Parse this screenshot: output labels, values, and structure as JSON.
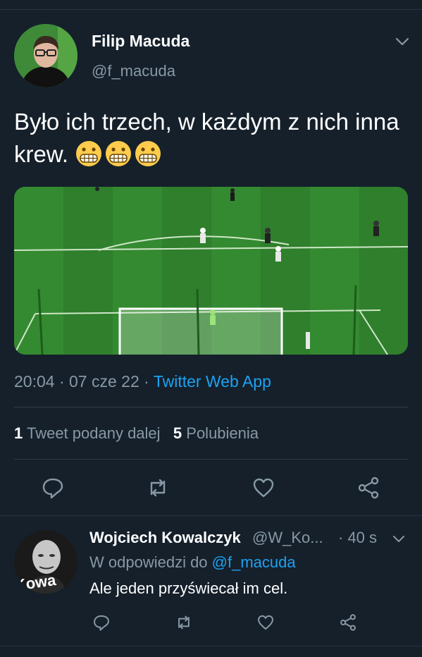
{
  "tweet": {
    "author_name": "Filip Macuda",
    "author_handle": "@f_macuda",
    "text": "Było ich trzech, w każdym z nich inna krew.",
    "emoji": [
      "grimacing-face",
      "grimacing-face",
      "grimacing-face"
    ],
    "time": "20:04",
    "date": "07 cze 22",
    "separator": "·",
    "source": "Twitter Web App",
    "retweets_count": "1",
    "retweets_label": "Tweet podany dalej",
    "likes_count": "5",
    "likes_label": "Polubienia"
  },
  "actions": [
    "reply-icon",
    "retweet-icon",
    "like-icon",
    "share-icon"
  ],
  "reply": {
    "author_name": "Wojciech Kowalczyk",
    "author_handle": "@W_Ko...",
    "time": "· 40 s",
    "reply_prefix": "W odpowiedzi do",
    "reply_to": "@f_macuda",
    "text": "Ale jeden przyświecał im cel.",
    "avatar_text": "Kowa"
  },
  "colors": {
    "background": "#15202b",
    "secondary_text": "#8899a6",
    "accent": "#1da1f2",
    "divider": "#2f3d4a"
  }
}
